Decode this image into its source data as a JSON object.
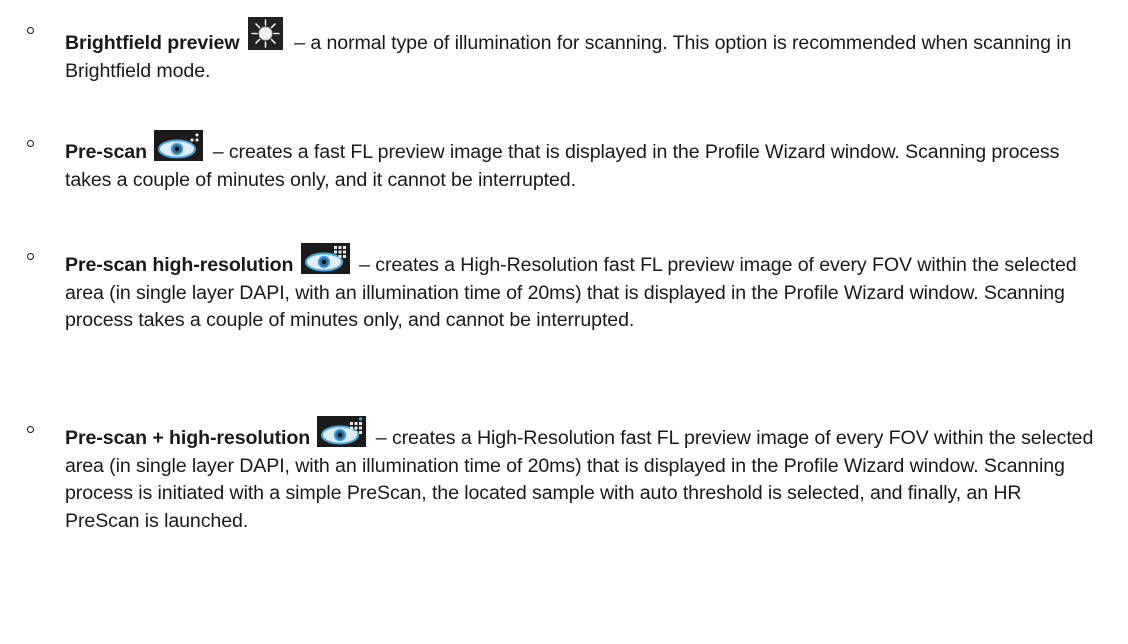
{
  "items": [
    {
      "term": "Brightfield preview",
      "icon": "brightfield-sun-icon",
      "description": " – a normal type of illumination for scanning. This option is recommended when scanning in Brightfield mode."
    },
    {
      "term": "Pre-scan",
      "icon": "prescan-eye-icon",
      "description": " – creates a fast FL preview image that is displayed in the Profile Wizard window. Scanning process takes a couple of minutes only, and it cannot be interrupted."
    },
    {
      "term": "Pre-scan high-resolution",
      "icon": "prescan-hr-eye-icon",
      "description": " – creates a High-Resolution fast FL preview image of every FOV within the selected area (in single layer DAPI, with an illumination time of 20ms) that is displayed in the Profile Wizard window. Scanning process takes a couple of minutes only, and cannot be interrupted."
    },
    {
      "term": "Pre-scan + high-resolution",
      "icon": "prescan-plus-hr-eye-icon",
      "description": " – creates a High-Resolution fast FL preview image of every FOV within the selected area (in single layer DAPI, with an illumination time of 20ms) that is displayed in the Profile Wizard window. Scanning process is initiated with a simple PreScan, the located sample with auto threshold is selected, and finally, an HR PreScan is launched."
    }
  ],
  "colors": {
    "text": "#1a1a1a",
    "icon_bg": "#1b1b1b",
    "icon_accent": "#4aa8e0"
  }
}
